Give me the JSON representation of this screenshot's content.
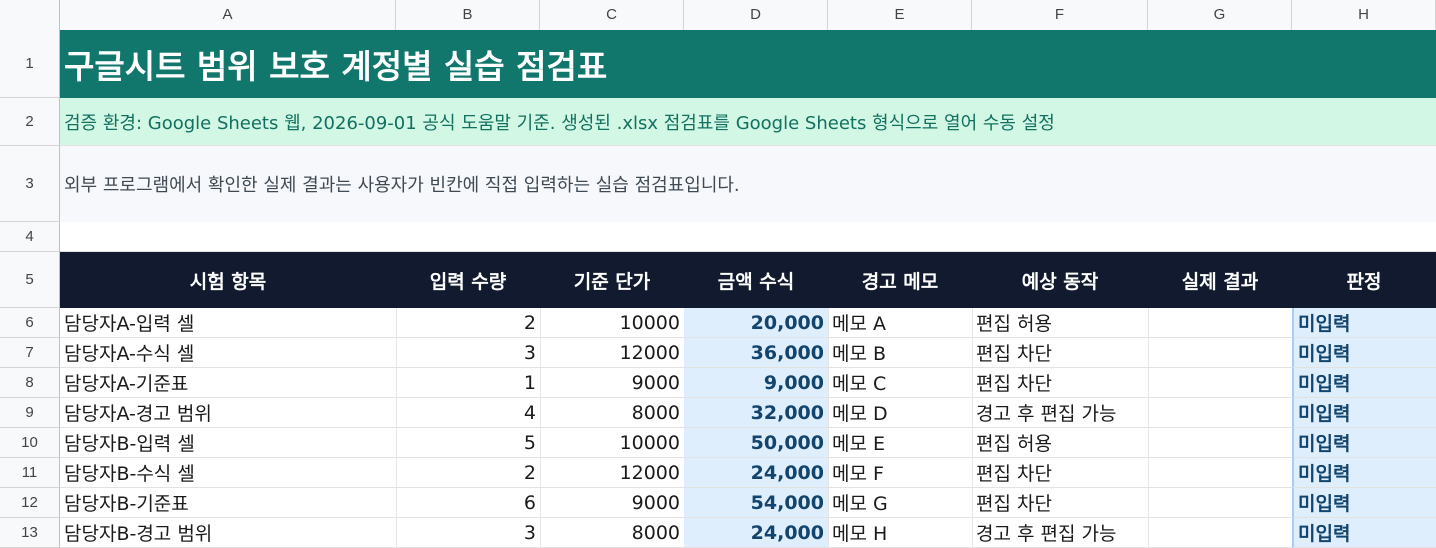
{
  "columns": [
    "A",
    "B",
    "C",
    "D",
    "E",
    "F",
    "G",
    "H"
  ],
  "row_numbers": [
    "1",
    "2",
    "3",
    "4",
    "5",
    "6",
    "7",
    "8",
    "9",
    "10",
    "11",
    "12",
    "13"
  ],
  "title": "구글시트 범위 보호 계정별 실습 점검표",
  "environment": "검증 환경: Google Sheets 웹, 2026-09-01 공식 도움말 기준. 생성된 .xlsx 점검표를 Google Sheets 형식으로 열어 수동 설정",
  "description": "외부 프로그램에서 확인한 실제 결과는 사용자가 빈칸에 직접 입력하는 실습 점검표입니다.",
  "headers": {
    "item": "시험 항목",
    "qty": "입력 수량",
    "price": "기준 단가",
    "amount": "금액 수식",
    "memo": "경고 메모",
    "expected": "예상 동작",
    "actual": "실제 결과",
    "judge": "판정"
  },
  "rows": [
    {
      "item": "담당자A-입력 셀",
      "qty": "2",
      "price": "10000",
      "amount": "20,000",
      "memo": "메모 A",
      "expected": "편집 허용",
      "actual": "",
      "judge": "미입력"
    },
    {
      "item": "담당자A-수식 셀",
      "qty": "3",
      "price": "12000",
      "amount": "36,000",
      "memo": "메모 B",
      "expected": "편집 차단",
      "actual": "",
      "judge": "미입력"
    },
    {
      "item": "담당자A-기준표",
      "qty": "1",
      "price": "9000",
      "amount": "9,000",
      "memo": "메모 C",
      "expected": "편집 차단",
      "actual": "",
      "judge": "미입력"
    },
    {
      "item": "담당자A-경고 범위",
      "qty": "4",
      "price": "8000",
      "amount": "32,000",
      "memo": "메모 D",
      "expected": "경고 후 편집 가능",
      "actual": "",
      "judge": "미입력"
    },
    {
      "item": "담당자B-입력 셀",
      "qty": "5",
      "price": "10000",
      "amount": "50,000",
      "memo": "메모 E",
      "expected": "편집 허용",
      "actual": "",
      "judge": "미입력"
    },
    {
      "item": "담당자B-수식 셀",
      "qty": "2",
      "price": "12000",
      "amount": "24,000",
      "memo": "메모 F",
      "expected": "편집 차단",
      "actual": "",
      "judge": "미입력"
    },
    {
      "item": "담당자B-기준표",
      "qty": "6",
      "price": "9000",
      "amount": "54,000",
      "memo": "메모 G",
      "expected": "편집 차단",
      "actual": "",
      "judge": "미입력"
    },
    {
      "item": "담당자B-경고 범위",
      "qty": "3",
      "price": "8000",
      "amount": "24,000",
      "memo": "메모 H",
      "expected": "경고 후 편집 가능",
      "actual": "",
      "judge": "미입력"
    }
  ],
  "colors": {
    "title_bg": "#11766b",
    "env_bg": "#d2f7e4",
    "header_bg": "#111a2e",
    "calc_bg": "#deeefc",
    "calc_text": "#13446e"
  }
}
